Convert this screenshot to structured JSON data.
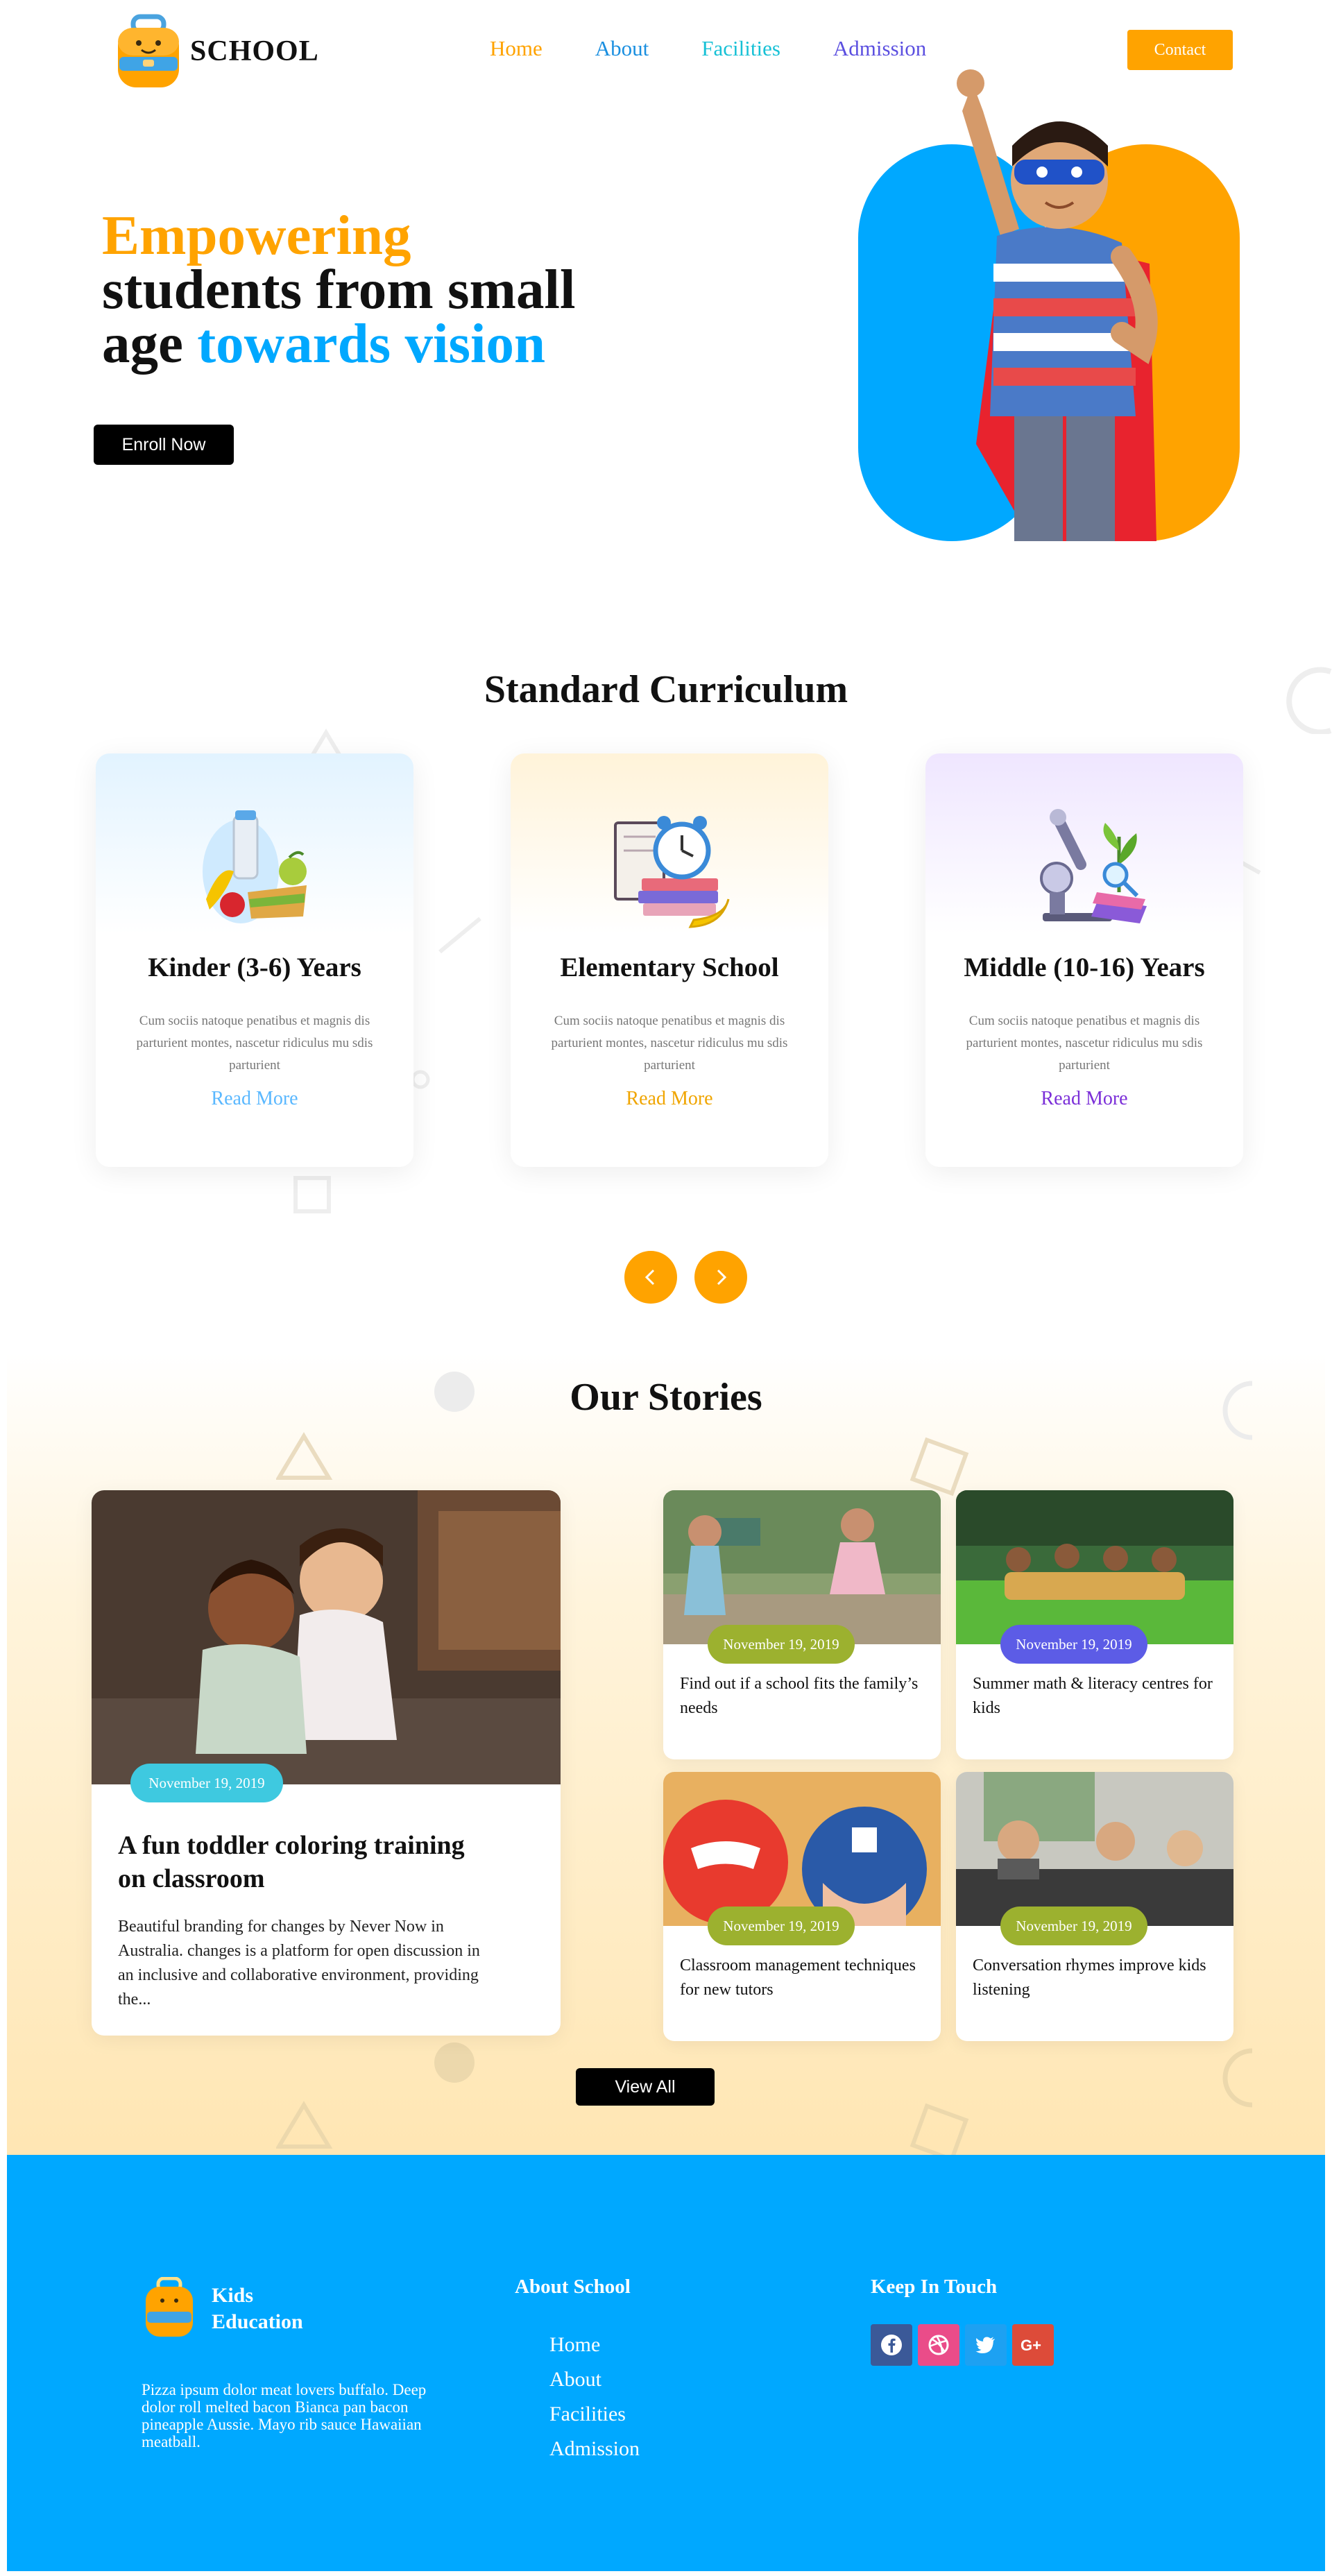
{
  "brand": {
    "name": "SCHOOL"
  },
  "nav": {
    "items": [
      {
        "label": "Home",
        "color": "#ffa300"
      },
      {
        "label": "About",
        "color": "#1a8fe0"
      },
      {
        "label": "Facilities",
        "color": "#17c1d6"
      },
      {
        "label": "Admission",
        "color": "#5b4fe0"
      }
    ],
    "contact_label": "Contact"
  },
  "hero": {
    "title_part1": "Empowering",
    "title_part2": "students from small age",
    "title_part3": "towards vision",
    "enroll_label": "Enroll Now"
  },
  "curriculum": {
    "title": "Standard Curriculum",
    "cards": [
      {
        "title": "Kinder (3-6) Years",
        "desc": "Cum sociis natoque penatibus et magnis dis parturient montes, nascetur ridiculus mu sdis parturient",
        "link": "Read More",
        "accent": "#5ab8ff",
        "bg": "#e2f3ff"
      },
      {
        "title": "Elementary School",
        "desc": "Cum sociis natoque penatibus et magnis dis parturient montes, nascetur ridiculus mu sdis parturient",
        "link": "Read More",
        "accent": "#f0a500",
        "bg": "#fff3d9"
      },
      {
        "title": "Middle (10-16) Years",
        "desc": "Cum sociis natoque penatibus et magnis dis parturient montes, nascetur ridiculus mu sdis parturient",
        "link": "Read More",
        "accent": "#7b2fd8",
        "bg": "#efe6ff"
      }
    ]
  },
  "stories": {
    "title": "Our Stories",
    "featured": {
      "date": "November 19, 2019",
      "title": "A fun toddler coloring training on classroom",
      "excerpt": "Beautiful branding for changes by Never Now in Australia. changes is a platform for open discussion in an inclusive and collaborative environment, providing the..."
    },
    "items": [
      {
        "date": "November 19, 2019",
        "title": "Find out if a school fits the family’s needs",
        "badge_color": "#9cb12f"
      },
      {
        "date": "November 19, 2019",
        "title": "Summer math & literacy centres for kids",
        "badge_color": "#5c5ce6"
      },
      {
        "date": "November 19, 2019",
        "title": "Classroom management techniques for new tutors",
        "badge_color": "#9cb12f"
      },
      {
        "date": "November 19, 2019",
        "title": "Conversation rhymes improve kids listening",
        "badge_color": "#9cb12f"
      }
    ],
    "view_all_label": "View All"
  },
  "footer": {
    "brand_line1": "Kids",
    "brand_line2": "Education",
    "about_text": "Pizza ipsum dolor meat lovers buffalo. Deep dolor roll melted bacon Bianca pan bacon pineapple Aussie. Mayo rib sauce Hawaiian meatball.",
    "about_heading": "About School",
    "links": [
      "Home",
      "About",
      "Facilities",
      "Admission"
    ],
    "touch_heading": "Keep In Touch",
    "social": [
      {
        "icon": "facebook-icon",
        "color": "#3b5998"
      },
      {
        "icon": "dribbble-icon",
        "color": "#ea4c89"
      },
      {
        "icon": "twitter-icon",
        "color": "#1da1f2"
      },
      {
        "icon": "google-plus-icon",
        "color": "#dd4b39"
      }
    ]
  }
}
